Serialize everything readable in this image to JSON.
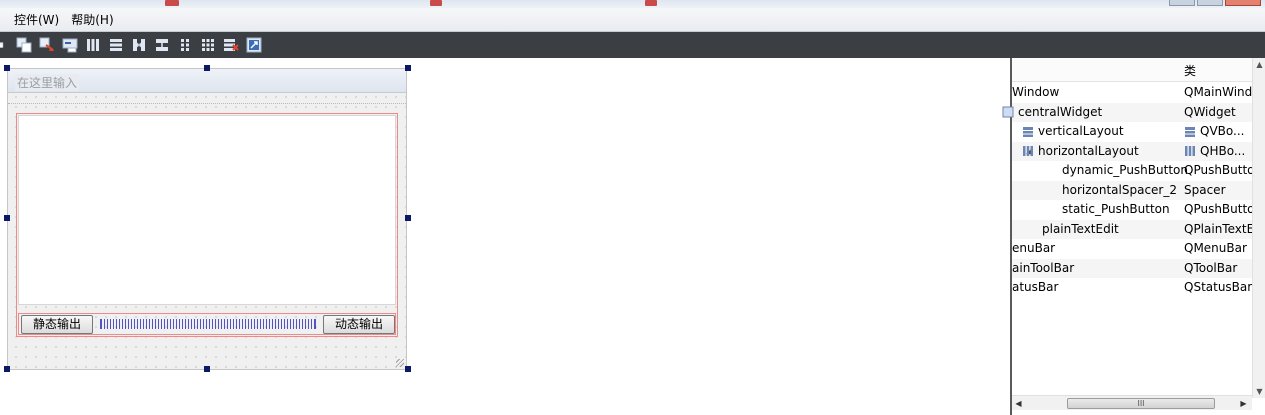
{
  "menubar": {
    "items": [
      "控件(W)",
      "帮助(H)"
    ]
  },
  "toolbar": {
    "buttons": [
      {
        "icon": "send-to-back-icon"
      },
      {
        "icon": "bring-to-front-icon"
      },
      {
        "icon": "edit-signals-icon"
      },
      {
        "icon": "edit-buddies-icon"
      },
      {
        "icon": "layout-horizontal-icon"
      },
      {
        "icon": "layout-vertical-icon"
      },
      {
        "icon": "layout-horizontal-splitter-icon"
      },
      {
        "icon": "layout-vertical-splitter-icon"
      },
      {
        "icon": "layout-form-icon"
      },
      {
        "icon": "layout-grid-icon"
      },
      {
        "icon": "break-layout-icon"
      },
      {
        "icon": "adjust-size-icon"
      }
    ]
  },
  "form": {
    "menu_placeholder": "在这里输入",
    "static_button": "静态输出",
    "dynamic_button": "动态输出"
  },
  "inspector": {
    "class_header": "类",
    "rows": [
      {
        "name": "Window",
        "cls": "QMainWind",
        "indent": 0,
        "icon": "",
        "expander": ""
      },
      {
        "name": "centralWidget",
        "cls": "QWidget",
        "indent": 10,
        "icon": "widget",
        "expander": ""
      },
      {
        "name": "verticalLayout",
        "cls": "QVBo...",
        "indent": 30,
        "icon": "vlayout",
        "expander": ""
      },
      {
        "name": "horizontalLayout",
        "cls": "QHBo...",
        "indent": 30,
        "icon": "hlayout",
        "expander": "◢"
      },
      {
        "name": "dynamic_PushButton",
        "cls": "QPushButto",
        "indent": 50,
        "icon": "",
        "expander": ""
      },
      {
        "name": "horizontalSpacer_2",
        "cls": "Spacer",
        "indent": 50,
        "icon": "",
        "expander": ""
      },
      {
        "name": "static_PushButton",
        "cls": "QPushButto",
        "indent": 50,
        "icon": "",
        "expander": ""
      },
      {
        "name": "plainTextEdit",
        "cls": "QPlainTextE",
        "indent": 30,
        "icon": "",
        "expander": ""
      },
      {
        "name": "enuBar",
        "cls": "QMenuBar",
        "indent": 0,
        "icon": "",
        "expander": ""
      },
      {
        "name": "ainToolBar",
        "cls": "QToolBar",
        "indent": 0,
        "icon": "",
        "expander": ""
      },
      {
        "name": "atusBar",
        "cls": "QStatusBar",
        "indent": 0,
        "icon": "",
        "expander": ""
      }
    ],
    "hscroll_grip": "III"
  },
  "colors": {
    "toolbar_bg": "#3b3e43",
    "layout_outline": "#f08a8a",
    "spacer": "#2c2cbf",
    "handle": "#0c1a66"
  }
}
